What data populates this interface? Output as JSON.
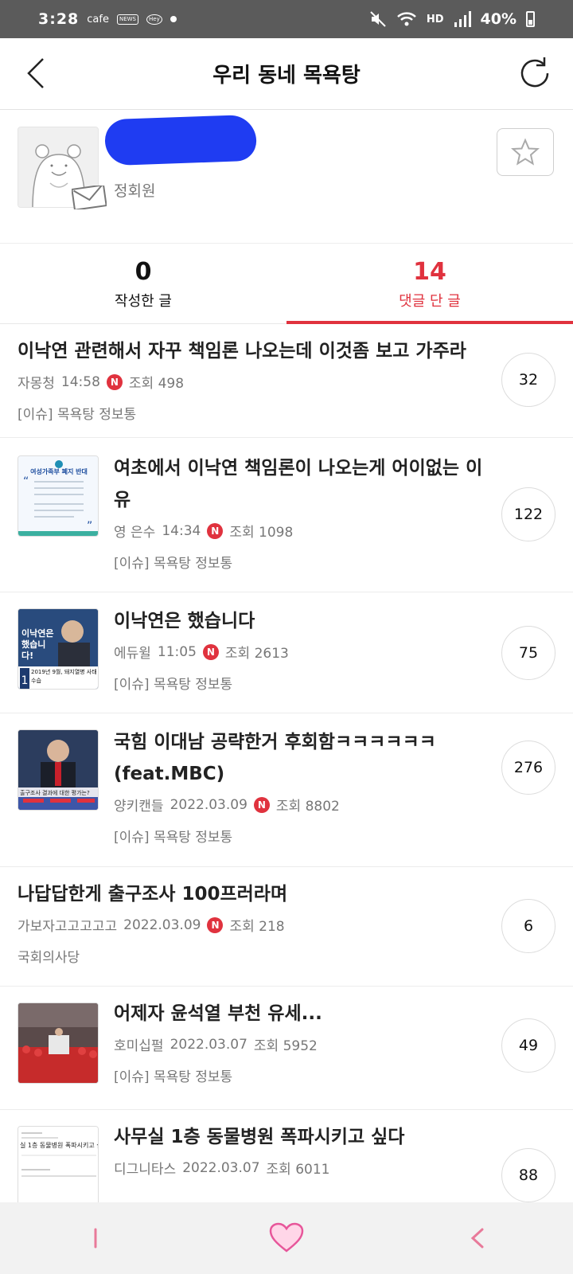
{
  "status_bar": {
    "time": "3:28",
    "app_label": "cafe",
    "news_label": "NEWS",
    "hey_label": "Hey",
    "network_label": "HD",
    "battery": "40%"
  },
  "header": {
    "title": "우리 동네 목욕탕"
  },
  "profile": {
    "grade": "정회원"
  },
  "tabs": [
    {
      "count": "0",
      "label": "작성한 글",
      "active": false
    },
    {
      "count": "14",
      "label": "댓글 단 글",
      "active": true
    }
  ],
  "posts": [
    {
      "title": "이낙연 관련해서 자꾸 책임론 나오는데 이것좀 보고 가주라",
      "author": "자몽청",
      "date": "14:58",
      "views": "조회 498",
      "board": "[이슈] 목욕탕 정보통",
      "comments": "32",
      "new": true
    },
    {
      "title": "여초에서 이낙연 책임론이 나오는게 어이없는 이유",
      "author": "영 은수",
      "date": "14:34",
      "views": "조회 1098",
      "board": "[이슈] 목욕탕 정보통",
      "comments": "122",
      "new": true,
      "thumb_text": "여성가족부 폐지 반대"
    },
    {
      "title": "이낙연은 했습니다",
      "author": "에듀윌",
      "date": "11:05",
      "views": "조회 2613",
      "board": "[이슈] 목욕탕 정보통",
      "comments": "75",
      "new": true,
      "thumb_text": "이낙연은 했습니다!",
      "thumb_sub": "2019년 9월, 돼지열병 사태 수습"
    },
    {
      "title": "국힘 이대남 공략한거 후회함ㅋㅋㅋㅋㅋㅋ(feat.MBC)",
      "author": "양키캔들",
      "date": "2022.03.09",
      "views": "조회 8802",
      "board": "[이슈] 목욕탕 정보통",
      "comments": "276",
      "new": true,
      "thumb_text": "출구조사 결과에 대한 평가는?"
    },
    {
      "title": "나답답한게 출구조사 100프러라며",
      "author": "가보자고고고고고",
      "date": "2022.03.09",
      "views": "조회 218",
      "board": "국회의사당",
      "comments": "6",
      "new": true
    },
    {
      "title": "어제자 윤석열 부천 유세...",
      "author": "호미십펄",
      "date": "2022.03.07",
      "views": "조회 5952",
      "board": "[이슈] 목욕탕 정보통",
      "comments": "49",
      "new": false
    },
    {
      "title": "사무실 1층 동물병원 폭파시키고 싶다",
      "author": "디그니타스",
      "date": "2022.03.07",
      "views": "조회 6011",
      "board": "",
      "comments": "88",
      "new": false,
      "thumb_text": "실 1층 동물병원 폭파시키고 싶"
    }
  ],
  "colors": {
    "accent": "#e0323e",
    "redaction": "#1f3cf2",
    "status_bar": "#5b5b5b"
  }
}
